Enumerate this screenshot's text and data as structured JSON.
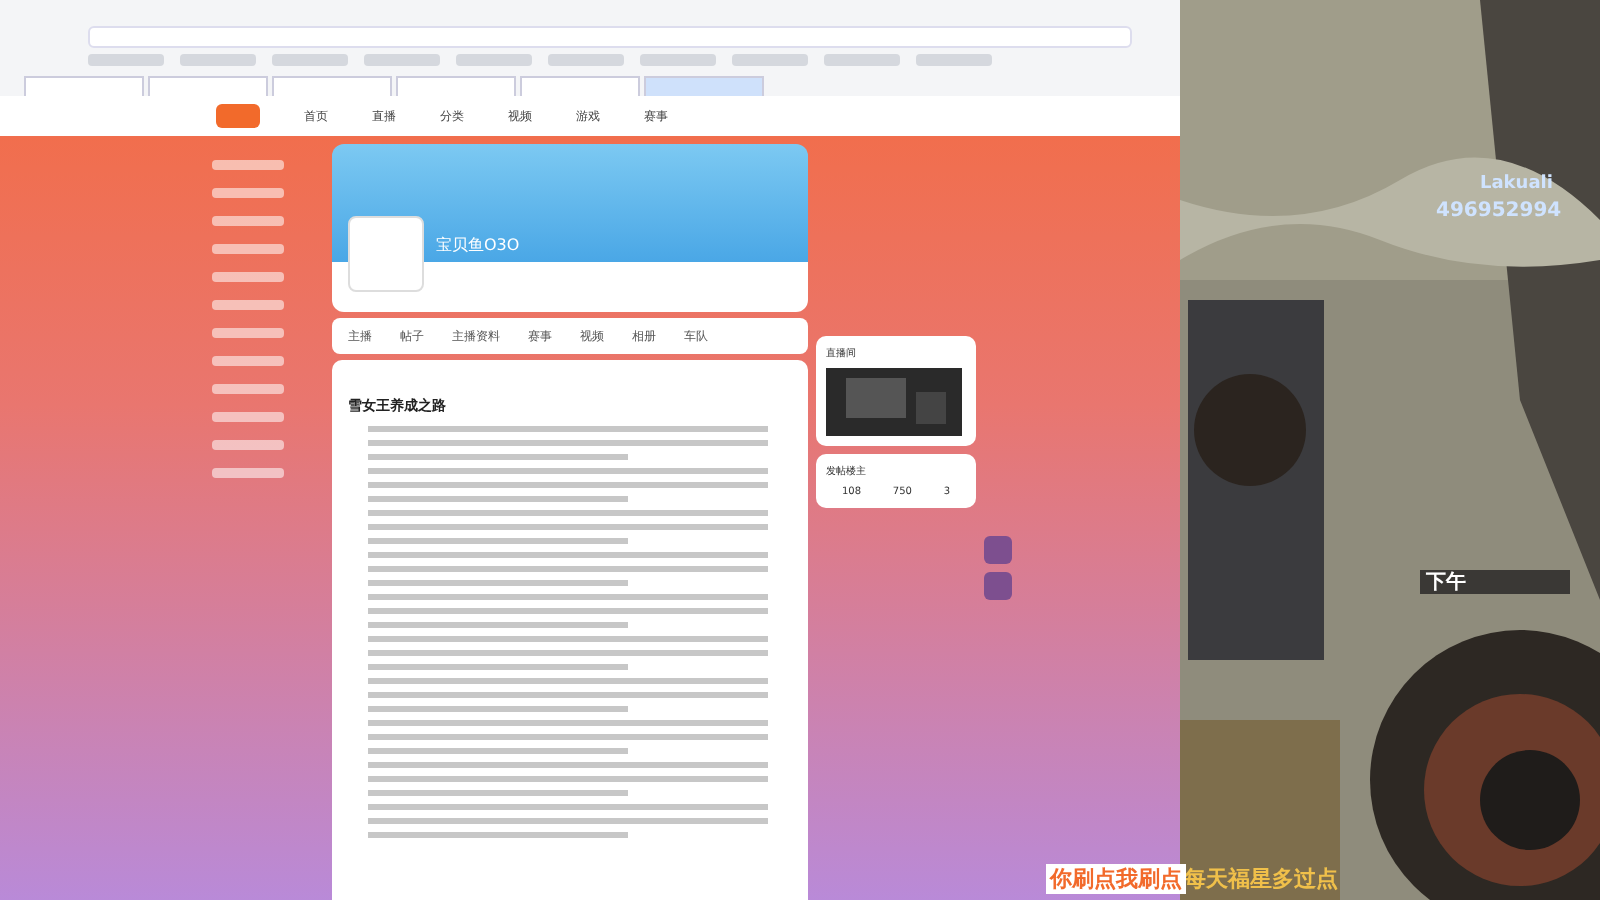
{
  "browser": {
    "tabs": [
      {
        "selected": false
      },
      {
        "selected": false
      },
      {
        "selected": false
      },
      {
        "selected": false
      },
      {
        "selected": false
      },
      {
        "selected": true
      }
    ]
  },
  "site_nav": {
    "items": [
      "首页",
      "直播",
      "分类",
      "视频",
      "游戏",
      "赛事"
    ]
  },
  "profile": {
    "name": "宝贝鱼O3O"
  },
  "profile_tabs": [
    "主播",
    "帖子",
    "主播资料",
    "赛事",
    "视频",
    "相册",
    "车队"
  ],
  "post": {
    "title": "雪女王养成之路"
  },
  "live_card": {
    "title": "直播间"
  },
  "author_card": {
    "title": "发帖楼主",
    "stats": [
      "108",
      "750",
      "3"
    ]
  },
  "overlay": {
    "qq": "496952994",
    "name": "Lakuali",
    "time": "下午",
    "caption_left": "你刷点我刷点",
    "caption_right": "每天福星多过点"
  }
}
